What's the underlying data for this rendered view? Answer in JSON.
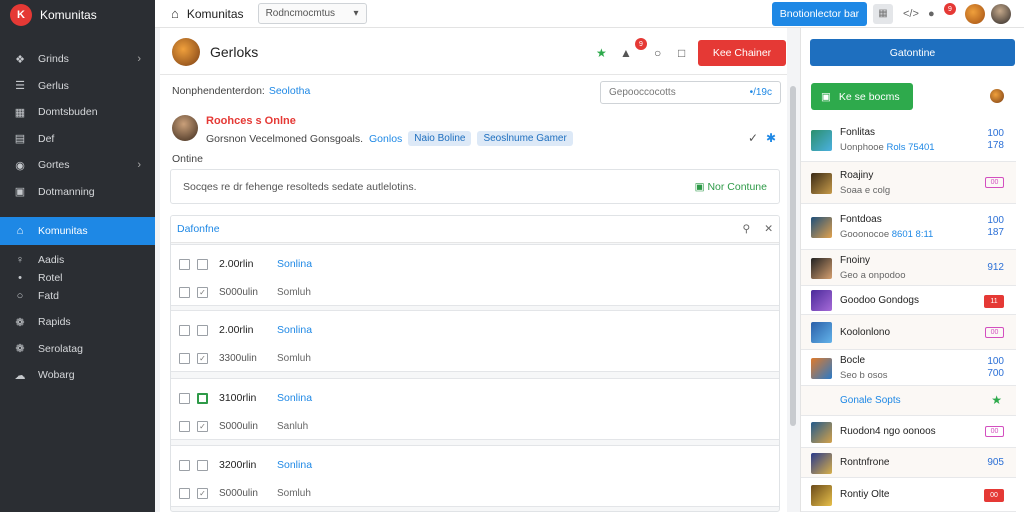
{
  "brand": {
    "logo": "K",
    "name": "Komunitas"
  },
  "sidebar": {
    "items": [
      {
        "icon": "users-icon",
        "glyph": "❖",
        "label": "Grinds",
        "chevron": true
      },
      {
        "icon": "list-icon",
        "glyph": "☰",
        "label": "Gerlus",
        "chevron": false
      },
      {
        "icon": "grid-icon",
        "glyph": "▦",
        "label": "Domtsbuden",
        "chevron": false
      },
      {
        "icon": "calendar-icon",
        "glyph": "▤",
        "label": "Def",
        "chevron": false
      },
      {
        "icon": "gamepad-icon",
        "glyph": "◉",
        "label": "Gortes",
        "chevron": true
      },
      {
        "icon": "book-icon",
        "glyph": "▣",
        "label": "Dotmanning",
        "chevron": false
      }
    ],
    "active": {
      "icon": "community-icon",
      "glyph": "⌂",
      "label": "Komunitas"
    },
    "subitems": [
      {
        "icon": "link-icon",
        "glyph": "♀",
        "label": "Aadis"
      },
      {
        "icon": "dot-icon",
        "glyph": "•",
        "label": "Rotel"
      },
      {
        "icon": "circle-icon",
        "glyph": "○",
        "label": "Fatd"
      }
    ],
    "bottom": [
      {
        "icon": "share-icon",
        "glyph": "❁",
        "label": "Rapids"
      },
      {
        "icon": "plug-icon",
        "glyph": "❁",
        "label": "Serolatag"
      },
      {
        "icon": "cloud-icon",
        "glyph": "☁",
        "label": "Wobarg"
      }
    ]
  },
  "topbar": {
    "title": "Komunitas",
    "select": "Rodncmocmtus",
    "button": "Bnotionlector bar",
    "badge1": "9",
    "badge2": "9"
  },
  "main": {
    "title": "Gerloks",
    "danger_button": "Kee Chainer",
    "header_badge": "9",
    "filter_label": "Nonphendenterdon:",
    "filter_link": "Seolotha",
    "filter_input": "Gepooccocotts",
    "filter_value": "•/19c",
    "author_name": "Roohces s Onlne",
    "author_meta": "Gorsnon Vecelmoned Gonsgoals.",
    "author_link": "Gonlos",
    "chip1": "Naio Boline",
    "chip2": "Seoslnume Gamer",
    "section_label": "Ontine",
    "note_text": "Socqes re dr fehenge resolteds sedate autlelotins.",
    "note_status": "Nor Contune",
    "list_title": "Dafonfne",
    "rows": [
      {
        "time": "2.00rlin",
        "name": "Sonlina",
        "sub_time": "S000ulin",
        "sub_name": "Somluh",
        "green": false
      },
      {
        "time": "2.00rlin",
        "name": "Sonlina",
        "sub_time": "3300ulin",
        "sub_name": "Somluh",
        "green": false
      },
      {
        "time": "3100rlin",
        "name": "Sonlina",
        "sub_time": "S000ulin",
        "sub_name": "Sanluh",
        "green": true
      },
      {
        "time": "3200rlin",
        "name": "Sonlina",
        "sub_time": "S000ulin",
        "sub_name": "Somluh",
        "green": false
      }
    ]
  },
  "right": {
    "button": "Gatontine",
    "green_button": "Ke se bocms",
    "items": [
      {
        "title": "Fonlitas",
        "sub": "Uonphooe",
        "sub_b": "Rols 75401",
        "val": "100\n178",
        "type": "val",
        "colors": [
          "#2b8f6c",
          "#4bb0e0"
        ]
      },
      {
        "title": "Roajiny",
        "sub": "Soaa e colg",
        "val": "00",
        "type": "pill",
        "colors": [
          "#3a2a16",
          "#c79b4a"
        ]
      },
      {
        "title": "Fontdoas",
        "sub": "Gooonocoe",
        "sub_b": "8601 8:11",
        "val": "100\n187",
        "type": "val",
        "colors": [
          "#1e4f7a",
          "#e2a24c"
        ]
      },
      {
        "title": "Fnoiny",
        "sub": "Geo a onpodoo",
        "val": "912",
        "type": "val",
        "colors": [
          "#222",
          "#d6a070"
        ]
      },
      {
        "title": "Goodoo Gondogs",
        "sub": "",
        "val": "11",
        "type": "red",
        "colors": [
          "#4a2a9a",
          "#a66bd8"
        ]
      },
      {
        "title": "Koolonlono",
        "sub": "",
        "val": "00",
        "type": "pill",
        "colors": [
          "#2a5fa8",
          "#63b3ea"
        ]
      },
      {
        "title": "Bocle",
        "sub": "Seo b osos",
        "val": "100\n700",
        "type": "val",
        "colors": [
          "#e07a2a",
          "#2a7ac8"
        ]
      },
      {
        "title": "Gonale Sopts",
        "sub": "",
        "val": "★",
        "type": "star",
        "colors": [
          "",
          ""
        ]
      },
      {
        "title": "Ruodon4 ngo oonoos",
        "sub": "",
        "val": "00",
        "type": "pill",
        "colors": [
          "#235a8a",
          "#d4a24a"
        ]
      },
      {
        "title": "Rontnfrone",
        "sub": "",
        "val": "905",
        "type": "val",
        "colors": [
          "#2a3a8a",
          "#d8b04a"
        ]
      },
      {
        "title": "Rontiy Olte",
        "sub": "",
        "val": "00",
        "type": "red",
        "colors": [
          "#6a4a1a",
          "#e8c04a"
        ]
      }
    ]
  }
}
